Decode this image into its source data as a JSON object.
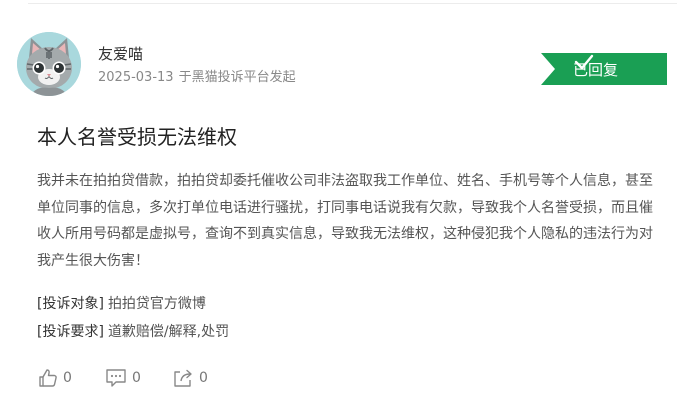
{
  "complaint": {
    "author": {
      "name": "友爱喵",
      "date": "2025-03-13",
      "source": "于黑猫投诉平台发起"
    },
    "status": {
      "label": "已回复",
      "color": "#1a9f54",
      "icon": "check-icon"
    },
    "title": "本人名誉受损无法维权",
    "content": "我并未在拍拍贷借款，拍拍贷却委托催收公司非法盗取我工作单位、姓名、手机号等个人信息，甚至单位同事的信息，多次打单位电话进行骚扰，打同事电话说我有欠款，导致我个人名誉受损，而且催收人所用号码都是虚拟号，查询不到真实信息，导致我无法维权，这种侵犯我个人隐私的违法行为对我产生很大伤害！",
    "target": {
      "label": "[投诉对象]",
      "value": "拍拍贷官方微博"
    },
    "demand": {
      "label": "[投诉要求]",
      "value": "道歉赔偿/解释,处罚"
    },
    "actions": {
      "likes": "0",
      "comments": "0",
      "shares": "0"
    }
  }
}
